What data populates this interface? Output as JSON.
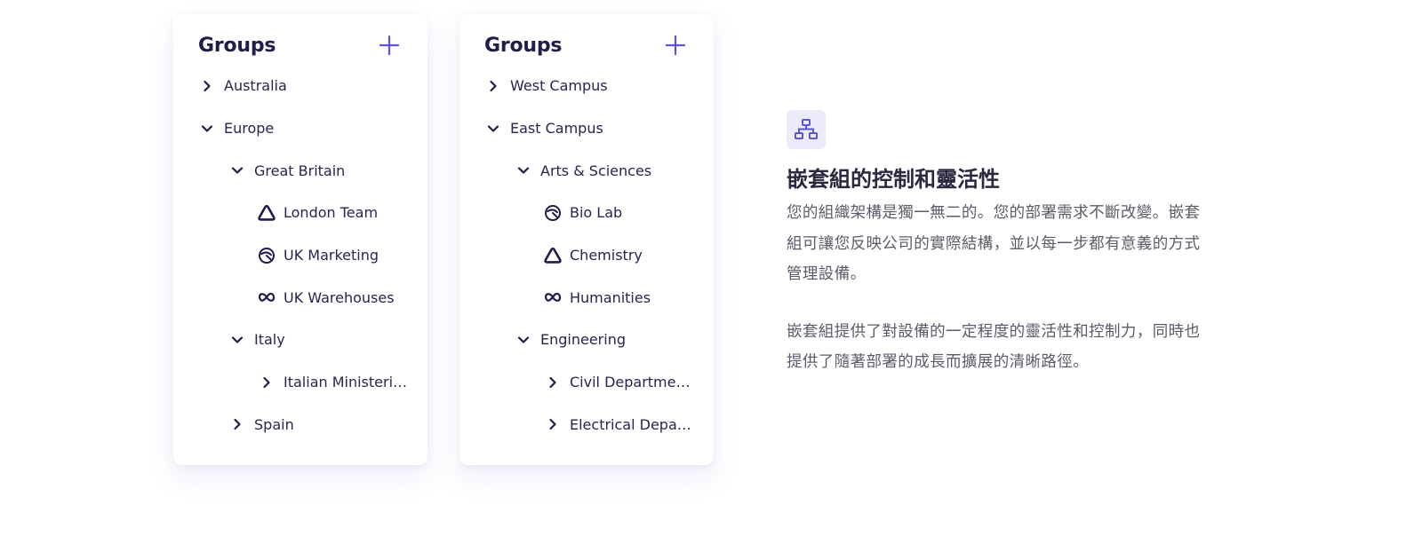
{
  "cards": [
    {
      "title": "Groups",
      "items": [
        {
          "label": "Australia",
          "icon": "chevron-right-icon",
          "level": 0
        },
        {
          "label": "Europe",
          "icon": "chevron-down-icon",
          "level": 0
        },
        {
          "label": "Great Britain",
          "icon": "chevron-down-icon",
          "level": 1
        },
        {
          "label": "London Team",
          "icon": "triangle-logo-icon",
          "level": 2
        },
        {
          "label": "UK Marketing",
          "icon": "gauge-logo-icon",
          "level": 2
        },
        {
          "label": "UK Warehouses",
          "icon": "infinity-logo-icon",
          "level": 2
        },
        {
          "label": "Italy",
          "icon": "chevron-down-icon",
          "level": 1
        },
        {
          "label": "Italian Ministeri…",
          "icon": "chevron-right-icon",
          "level": 2
        },
        {
          "label": "Spain",
          "icon": "chevron-right-icon",
          "level": 1
        }
      ]
    },
    {
      "title": "Groups",
      "items": [
        {
          "label": "West Campus",
          "icon": "chevron-right-icon",
          "level": 0
        },
        {
          "label": "East Campus",
          "icon": "chevron-down-icon",
          "level": 0
        },
        {
          "label": "Arts & Sciences",
          "icon": "chevron-down-icon",
          "level": 1
        },
        {
          "label": "Bio Lab",
          "icon": "gauge-logo-icon",
          "level": 2
        },
        {
          "label": "Chemistry",
          "icon": "triangle-logo-icon",
          "level": 2
        },
        {
          "label": "Humanities",
          "icon": "infinity-logo-icon",
          "level": 2
        },
        {
          "label": "Engineering",
          "icon": "chevron-down-icon",
          "level": 1
        },
        {
          "label": "Civil Departmen…",
          "icon": "chevron-right-icon",
          "level": 2
        },
        {
          "label": "Electrical Depar…",
          "icon": "chevron-right-icon",
          "level": 2
        }
      ]
    }
  ],
  "feature": {
    "icon": "hierarchy-icon",
    "title": "嵌套組的控制和靈活性",
    "paragraph1_lines": [
      "您的組織架構是獨一無二的。您的部署需求不斷改變。嵌套",
      "組可讓您反映公司的實際結構，並以每一步都有意義的方式",
      "管理設備。"
    ],
    "paragraph2_lines": [
      "嵌套組提供了對設備的一定程度的靈活性和控制力，同時也",
      "提供了隨著部署的成長而擴展的清晰路徑。"
    ]
  },
  "colors": {
    "accent": "#5a55d6",
    "accent_soft": "#ecebfb",
    "icon_dark": "#1f1d4a",
    "body_text": "#5d5b6b"
  }
}
